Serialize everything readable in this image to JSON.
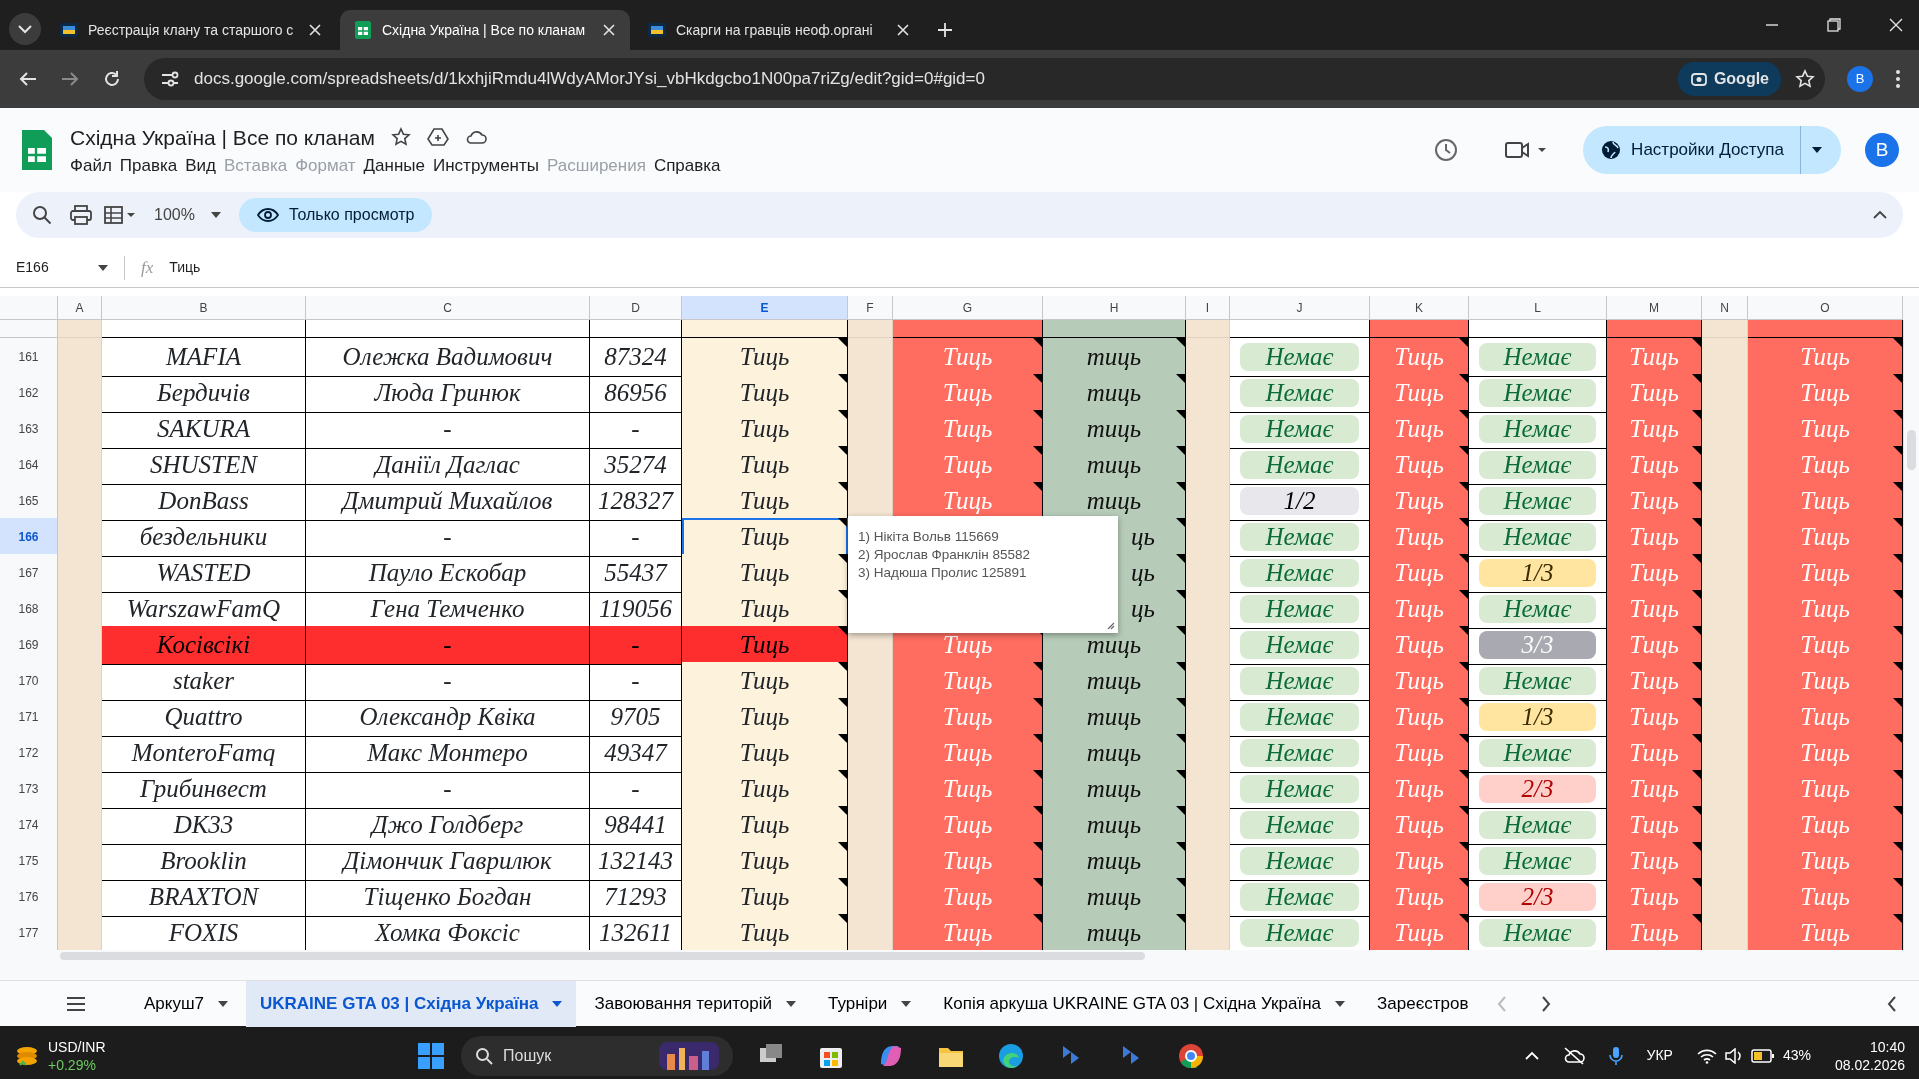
{
  "browser": {
    "tabs": [
      {
        "title": "Реєстрація клану та старшого с",
        "selected": false,
        "kind": "clan"
      },
      {
        "title": "Східна Україна | Все по кланам",
        "selected": true,
        "kind": "sheets"
      },
      {
        "title": "Скарги на гравців неоф.органі",
        "selected": false,
        "kind": "clan"
      }
    ],
    "url": "docs.google.com/spreadsheets/d/1kxhjiRmdu4lWdyAMorJYsi_vbHkdgcbo1N00pa7riZg/edit?gid=0#gid=0",
    "lens_button": "Google",
    "profile": "B"
  },
  "doc": {
    "title": "Східна Україна | Все по кланам",
    "menu": [
      {
        "label": "Файл",
        "disabled": false
      },
      {
        "label": "Правка",
        "disabled": false
      },
      {
        "label": "Вид",
        "disabled": false
      },
      {
        "label": "Вставка",
        "disabled": true
      },
      {
        "label": "Формат",
        "disabled": true
      },
      {
        "label": "Данные",
        "disabled": false
      },
      {
        "label": "Инструменты",
        "disabled": false
      },
      {
        "label": "Расширения",
        "disabled": true
      },
      {
        "label": "Справка",
        "disabled": false
      }
    ],
    "share_button": "Настройки Доступа",
    "avatar": "B"
  },
  "toolbar": {
    "zoom": "100%",
    "view_only": "Только просмотр"
  },
  "formula_bar": {
    "cell_ref": "E166",
    "fx": "fx",
    "value": "Тиць"
  },
  "columns": [
    {
      "label": "A",
      "selected": false
    },
    {
      "label": "B",
      "selected": false
    },
    {
      "label": "C",
      "selected": false
    },
    {
      "label": "D",
      "selected": false
    },
    {
      "label": "E",
      "selected": true
    },
    {
      "label": "F",
      "selected": false
    },
    {
      "label": "G",
      "selected": false
    },
    {
      "label": "H",
      "selected": false
    },
    {
      "label": "I",
      "selected": false
    },
    {
      "label": "J",
      "selected": false
    },
    {
      "label": "K",
      "selected": false
    },
    {
      "label": "L",
      "selected": false
    },
    {
      "label": "M",
      "selected": false
    },
    {
      "label": "N",
      "selected": false
    },
    {
      "label": "O",
      "selected": false
    }
  ],
  "rows": [
    {
      "num": "161",
      "selected": false,
      "alert": false,
      "b": "MAFIA",
      "c": "Олежка Вадимович",
      "d": "87324",
      "e": "Тиць",
      "g": "Тиць",
      "h": "тиць",
      "j": {
        "text": "Немає",
        "kind": "none"
      },
      "k": "Тиць",
      "l": {
        "text": "Немає",
        "kind": "none"
      },
      "m": "Тиць",
      "o": "Тиць"
    },
    {
      "num": "162",
      "selected": false,
      "alert": false,
      "b": "Бердичів",
      "c": "Люда Гринюк",
      "d": "86956",
      "e": "Тиць",
      "g": "Тиць",
      "h": "тиць",
      "j": {
        "text": "Немає",
        "kind": "none"
      },
      "k": "Тиць",
      "l": {
        "text": "Немає",
        "kind": "none"
      },
      "m": "Тиць",
      "o": "Тиць"
    },
    {
      "num": "163",
      "selected": false,
      "alert": false,
      "b": "SAKURA",
      "c": "-",
      "d": "-",
      "e": "Тиць",
      "g": "Тиць",
      "h": "тиць",
      "j": {
        "text": "Немає",
        "kind": "none"
      },
      "k": "Тиць",
      "l": {
        "text": "Немає",
        "kind": "none"
      },
      "m": "Тиць",
      "o": "Тиць"
    },
    {
      "num": "164",
      "selected": false,
      "alert": false,
      "b": "SHUSTEN",
      "c": "Даніїл Даглас",
      "d": "35274",
      "e": "Тиць",
      "g": "Тиць",
      "h": "тиць",
      "j": {
        "text": "Немає",
        "kind": "none"
      },
      "k": "Тиць",
      "l": {
        "text": "Немає",
        "kind": "none"
      },
      "m": "Тиць",
      "o": "Тиць"
    },
    {
      "num": "165",
      "selected": false,
      "alert": false,
      "b": "DonBass",
      "c": "Дмитрий Михайлов",
      "d": "128327",
      "e": "Тиць",
      "g": "Тиць",
      "h": "тиць",
      "j": {
        "text": "1/2",
        "kind": "gray"
      },
      "k": "Тиць",
      "l": {
        "text": "Немає",
        "kind": "none"
      },
      "m": "Тиць",
      "o": "Тиць"
    },
    {
      "num": "166",
      "selected": true,
      "alert": false,
      "b": "бездельники",
      "c": "-",
      "d": "-",
      "e": "Тиць",
      "h": "ць",
      "j": {
        "text": "Немає",
        "kind": "none"
      },
      "k": "Тиць",
      "l": {
        "text": "Немає",
        "kind": "none"
      },
      "m": "Тиць",
      "o": "Тиць"
    },
    {
      "num": "167",
      "selected": false,
      "alert": false,
      "b": "WASTED",
      "c": "Пауло Ескобар",
      "d": "55437",
      "e": "Тиць",
      "h": "ць",
      "j": {
        "text": "Немає",
        "kind": "none"
      },
      "k": "Тиць",
      "l": {
        "text": "1/3",
        "kind": "yellow"
      },
      "m": "Тиць",
      "o": "Тиць"
    },
    {
      "num": "168",
      "selected": false,
      "alert": false,
      "b": "WarszawFamQ",
      "c": "Гена Темченко",
      "d": "119056",
      "e": "Тиць",
      "h": "ць",
      "j": {
        "text": "Немає",
        "kind": "none"
      },
      "k": "Тиць",
      "l": {
        "text": "Немає",
        "kind": "none"
      },
      "m": "Тиць",
      "o": "Тиць"
    },
    {
      "num": "169",
      "selected": false,
      "alert": true,
      "b": "Косівсікі",
      "c": "-",
      "d": "-",
      "e": "Тиць",
      "g": "Тиць",
      "h": "тиць",
      "j": {
        "text": "Немає",
        "kind": "none"
      },
      "k": "Тиць",
      "l": {
        "text": "3/3",
        "kind": "done"
      },
      "m": "Тиць",
      "o": "Тиць"
    },
    {
      "num": "170",
      "selected": false,
      "alert": false,
      "b": "staker",
      "c": "-",
      "d": "-",
      "e": "Тиць",
      "g": "Тиць",
      "h": "тиць",
      "j": {
        "text": "Немає",
        "kind": "none"
      },
      "k": "Тиць",
      "l": {
        "text": "Немає",
        "kind": "none"
      },
      "m": "Тиць",
      "o": "Тиць"
    },
    {
      "num": "171",
      "selected": false,
      "alert": false,
      "b": "Quattro",
      "c": "Олександр Квіка",
      "d": "9705",
      "e": "Тиць",
      "g": "Тиць",
      "h": "тиць",
      "j": {
        "text": "Немає",
        "kind": "none"
      },
      "k": "Тиць",
      "l": {
        "text": "1/3",
        "kind": "yellow"
      },
      "m": "Тиць",
      "o": "Тиць"
    },
    {
      "num": "172",
      "selected": false,
      "alert": false,
      "b": "MonteroFamq",
      "c": "Макс Монтеро",
      "d": "49347",
      "e": "Тиць",
      "g": "Тиць",
      "h": "тиць",
      "j": {
        "text": "Немає",
        "kind": "none"
      },
      "k": "Тиць",
      "l": {
        "text": "Немає",
        "kind": "none"
      },
      "m": "Тиць",
      "o": "Тиць"
    },
    {
      "num": "173",
      "selected": false,
      "alert": false,
      "b": "Грибинвест",
      "c": "-",
      "d": "-",
      "e": "Тиць",
      "g": "Тиць",
      "h": "тиць",
      "j": {
        "text": "Немає",
        "kind": "none"
      },
      "k": "Тиць",
      "l": {
        "text": "2/3",
        "kind": "pink"
      },
      "m": "Тиць",
      "o": "Тиць"
    },
    {
      "num": "174",
      "selected": false,
      "alert": false,
      "b": "DK33",
      "c": "Джо Голдберг",
      "d": "98441",
      "e": "Тиць",
      "g": "Тиць",
      "h": "тиць",
      "j": {
        "text": "Немає",
        "kind": "none"
      },
      "k": "Тиць",
      "l": {
        "text": "Немає",
        "kind": "none"
      },
      "m": "Тиць",
      "o": "Тиць"
    },
    {
      "num": "175",
      "selected": false,
      "alert": false,
      "b": "Brooklin",
      "c": "Дімончик Гаврилюк",
      "d": "132143",
      "e": "Тиць",
      "g": "Тиць",
      "h": "тиць",
      "j": {
        "text": "Немає",
        "kind": "none"
      },
      "k": "Тиць",
      "l": {
        "text": "Немає",
        "kind": "none"
      },
      "m": "Тиць",
      "o": "Тиць"
    },
    {
      "num": "176",
      "selected": false,
      "alert": false,
      "b": "BRAXTON",
      "c": "Тіщенко Богдан",
      "d": "71293",
      "e": "Тиць",
      "g": "Тиць",
      "h": "тиць",
      "j": {
        "text": "Немає",
        "kind": "none"
      },
      "k": "Тиць",
      "l": {
        "text": "2/3",
        "kind": "pink"
      },
      "m": "Тиць",
      "o": "Тиць"
    },
    {
      "num": "177",
      "selected": false,
      "alert": false,
      "b": "FOXIS",
      "c": "Хомка Фоксіс",
      "d": "132611",
      "e": "Тиць",
      "g": "Тиць",
      "h": "тиць",
      "j": {
        "text": "Немає",
        "kind": "none"
      },
      "k": "Тиць",
      "l": {
        "text": "Немає",
        "kind": "none"
      },
      "m": "Тиць",
      "o": "Тиць"
    }
  ],
  "note": {
    "lines": [
      "1) Нікіта Вольв 115669",
      "2) Ярослав Франклін 85582",
      "3) Надюша Пролис 125891"
    ]
  },
  "sheet_tabs": [
    {
      "label": "Аркуш7",
      "selected": false,
      "menu": true
    },
    {
      "label": "UKRAINE GTA 03 | Східна Україна",
      "selected": true,
      "menu": true
    },
    {
      "label": "Завоювання територій",
      "selected": false,
      "menu": true
    },
    {
      "label": "Турніри",
      "selected": false,
      "menu": true
    },
    {
      "label": "Копія аркуша UKRAINE GTA 03 | Східна Україна",
      "selected": false,
      "menu": true
    },
    {
      "label": "Зареєстров",
      "selected": false,
      "menu": false
    }
  ],
  "taskbar": {
    "ticker": "USD/INR",
    "change": "+0.29%",
    "search": "Пошук",
    "lang": "УКР",
    "battery": "43%",
    "time": "10:40",
    "date": "08.02.2026"
  }
}
